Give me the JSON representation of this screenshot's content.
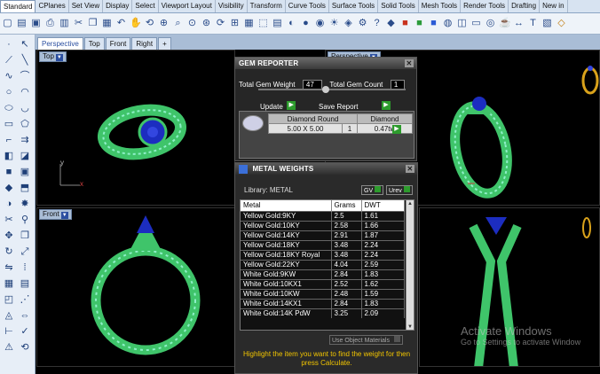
{
  "tabs": [
    "Standard",
    "CPlanes",
    "Set View",
    "Display",
    "Select",
    "Viewport Layout",
    "Visibility",
    "Transform",
    "Curve Tools",
    "Surface Tools",
    "Solid Tools",
    "Mesh Tools",
    "Render Tools",
    "Drafting",
    "New in"
  ],
  "viewport_tabs": [
    "Perspective",
    "Top",
    "Front",
    "Right"
  ],
  "viewports": {
    "top_left": "Top",
    "top_right": "Perspective",
    "bottom_left": "Front",
    "axis_x": "x",
    "axis_y": "y",
    "axis_z": "z"
  },
  "gem_reporter": {
    "title": "GEM REPORTER",
    "total_weight_label": "Total Gem Weight",
    "total_weight_value": "47",
    "total_count_label": "Total Gem Count",
    "total_count_value": "1",
    "update_label": "Update",
    "save_label": "Save Report",
    "gem": {
      "shape": "Diamond Round",
      "type": "Diamond",
      "size": "5.00 X 5.00",
      "count": "1",
      "weight": "0.47tw"
    }
  },
  "metal_weights": {
    "title": "METAL WEIGHTS",
    "library_label": "Library: METAL",
    "gv_label": "GV",
    "urev_label": "Urev",
    "columns": [
      "Metal",
      "Grams",
      "DWT"
    ],
    "rows": [
      [
        "Yellow Gold:9KY",
        "2.5",
        "1.61"
      ],
      [
        "Yellow Gold:10KY",
        "2.58",
        "1.66"
      ],
      [
        "Yellow Gold:14KY",
        "2.91",
        "1.87"
      ],
      [
        "Yellow Gold:18KY",
        "3.48",
        "2.24"
      ],
      [
        "Yellow Gold:18KY Royal",
        "3.48",
        "2.24"
      ],
      [
        "Yellow Gold:22KY",
        "4.04",
        "2.59"
      ],
      [
        "White Gold:9KW",
        "2.84",
        "1.83"
      ],
      [
        "White Gold:10KX1",
        "2.52",
        "1.62"
      ],
      [
        "White Gold:10KW",
        "2.48",
        "1.59"
      ],
      [
        "White Gold:14KX1",
        "2.84",
        "1.83"
      ],
      [
        "White Gold:14K PdW",
        "3.25",
        "2.09"
      ]
    ],
    "use_object_materials": "Use Object Materials",
    "hint": "Highlight the item you want to find the weight for then press Calculate."
  },
  "watermark": {
    "title": "Activate Windows",
    "subtitle": "Go to Settings to activate Window"
  },
  "colors": {
    "ring_green": "#3fc46a",
    "gem_blue": "#2030c8",
    "bead": "#c8f2e6",
    "hint_text": "#f2c500"
  }
}
